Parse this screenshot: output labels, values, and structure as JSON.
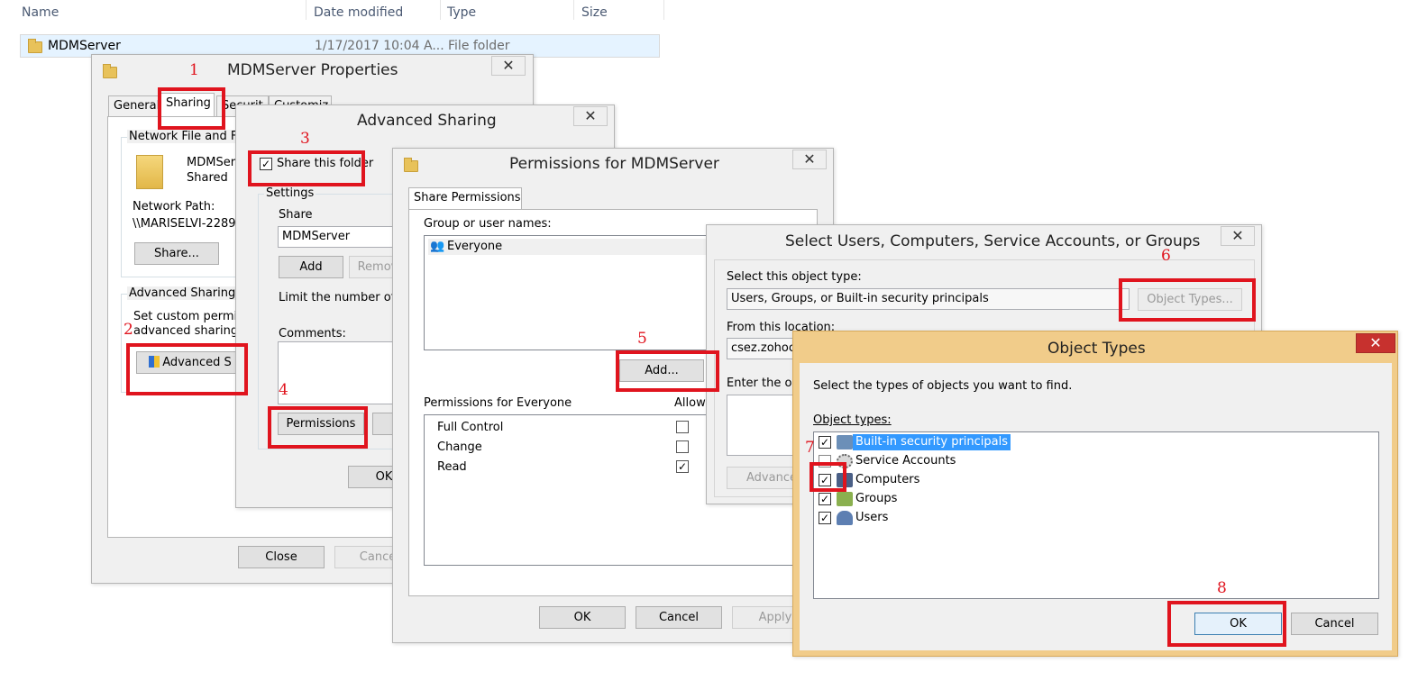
{
  "explorer": {
    "columns": {
      "name": "Name",
      "date_modified": "Date modified",
      "type": "Type",
      "size": "Size"
    },
    "row": {
      "name": "MDMServer",
      "date_modified": "1/17/2017 10:04 A...",
      "type": "File folder"
    }
  },
  "properties_dialog": {
    "title": "MDMServer Properties",
    "tabs": [
      "General",
      "Sharing",
      "Securit",
      "Customiz"
    ],
    "network_group_label": "Network File and Fo",
    "folder_name": "MDMSer",
    "shared_status": "Shared",
    "network_path_label": "Network Path:",
    "network_path_value": "\\\\MARISELVI-2289\\",
    "share_button": "Share...",
    "advanced_group_label": "Advanced Sharing",
    "advanced_desc_line1": "Set custom permiss",
    "advanced_desc_line2": "advanced sharing o",
    "advanced_button": "Advanced S",
    "close_button": "Close",
    "cancel_button": "Cance"
  },
  "advanced_sharing_dialog": {
    "title": "Advanced Sharing",
    "share_checkbox_label": "Share this folder",
    "share_checked": true,
    "settings_label": "Settings",
    "share_label": "Share",
    "share_name_value": "MDMServer",
    "add_button": "Add",
    "remove_button": "Remove",
    "limit_label": "Limit the number of si",
    "comments_label": "Comments:",
    "permissions_button": "Permissions",
    "caching_button": "C",
    "ok_button": "OK"
  },
  "permissions_dialog": {
    "title": "Permissions for MDMServer",
    "tab": "Share Permissions",
    "group_label": "Group or user names:",
    "users": [
      "Everyone"
    ],
    "add_button": "Add...",
    "perm_label": "Permissions for Everyone",
    "allow_header": "Allow",
    "permissions": [
      {
        "name": "Full Control",
        "allow": false
      },
      {
        "name": "Change",
        "allow": false
      },
      {
        "name": "Read",
        "allow": true
      }
    ],
    "ok_button": "OK",
    "cancel_button": "Cancel",
    "apply_button": "Apply"
  },
  "select_users_dialog": {
    "title": "Select Users, Computers, Service Accounts, or Groups",
    "object_type_label": "Select this object type:",
    "object_type_value": "Users, Groups, or Built-in security principals",
    "object_types_button": "Object Types...",
    "location_label": "From this location:",
    "location_value": "csez.zohoco",
    "enter_label": "Enter the obj",
    "advanced_button": "Advance"
  },
  "object_types_dialog": {
    "title": "Object Types",
    "description": "Select the types of objects you want to find.",
    "list_label": "Object types:",
    "items": [
      {
        "name": "Built-in security principals",
        "checked": true,
        "icon": "security-principals-icon"
      },
      {
        "name": "Service Accounts",
        "checked": false,
        "icon": "service-accounts-icon"
      },
      {
        "name": "Computers",
        "checked": true,
        "icon": "computer-icon"
      },
      {
        "name": "Groups",
        "checked": true,
        "icon": "groups-icon"
      },
      {
        "name": "Users",
        "checked": true,
        "icon": "user-icon"
      }
    ],
    "ok_button": "OK",
    "cancel_button": "Cancel"
  },
  "annotations": [
    "1",
    "2",
    "3",
    "4",
    "5",
    "6",
    "7",
    "8"
  ],
  "colors": {
    "annotation": "#e0141e",
    "object_types_frame": "#f1cc8a",
    "selection": "#3399ff"
  }
}
